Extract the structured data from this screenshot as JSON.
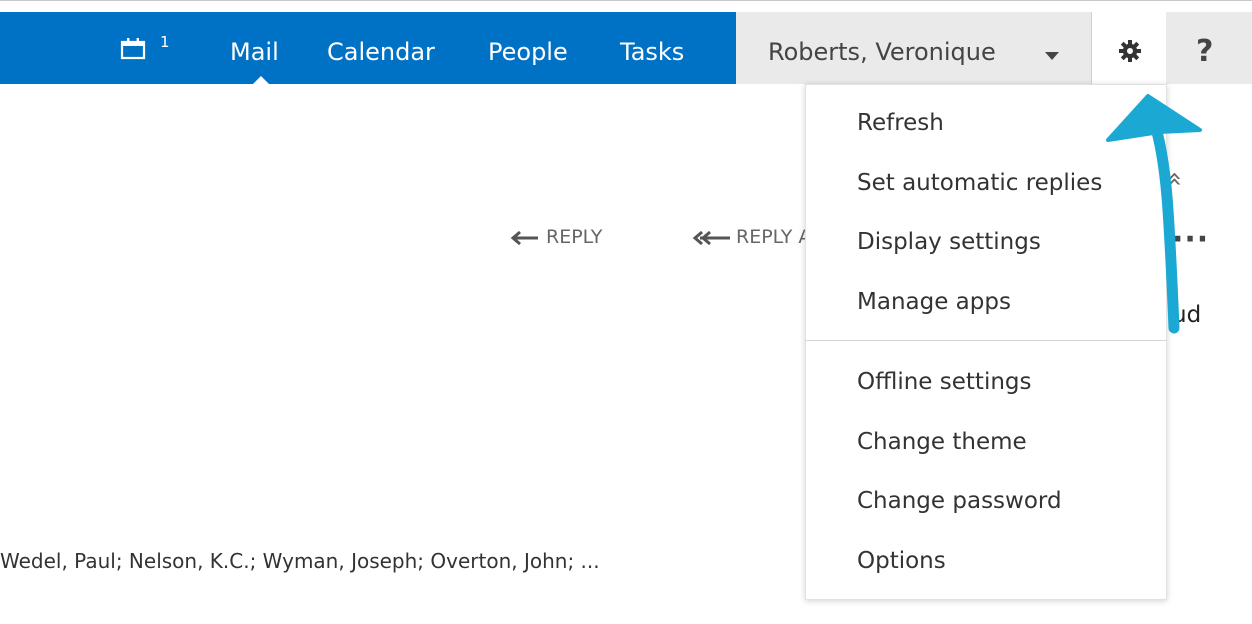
{
  "topbar": {
    "calendar_badge": "1",
    "nav": {
      "mail": "Mail",
      "calendar": "Calendar",
      "people": "People",
      "tasks": "Tasks"
    },
    "user_name": "Roberts, Veronique",
    "help": "?",
    "accent_color": "#0072c6"
  },
  "message": {
    "reply_label": "REPLY",
    "reply_all_label": "REPLY ALL",
    "partial_text": "ud",
    "more_label": "···",
    "expand_label": "»",
    "recipients": "Wedel, Paul;   Nelson, K.C.;   Wyman, Joseph;   Overton, John;   ..."
  },
  "settings_menu": {
    "items": [
      "Refresh",
      "Set automatic replies",
      "Display settings",
      "Manage apps",
      "Offline settings",
      "Change theme",
      "Change password",
      "Options"
    ]
  },
  "icons": {
    "calendar": "calendar-icon",
    "gear": "gear-icon",
    "reply": "arrow-left-icon",
    "reply_all": "double-arrow-left-icon",
    "annotation": "annotation-arrow-icon"
  }
}
